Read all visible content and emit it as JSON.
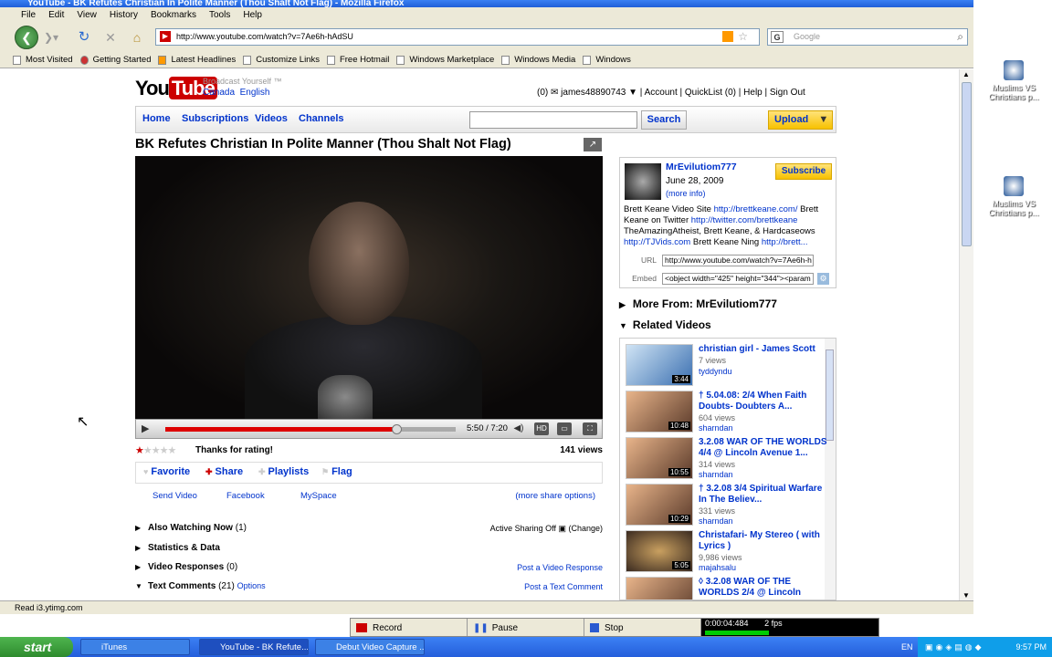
{
  "window": {
    "title": "YouTube - BK Refutes Christian In Polite Manner (Thou Shalt Not Flag) - Mozilla Firefox"
  },
  "menu": [
    "File",
    "Edit",
    "View",
    "History",
    "Bookmarks",
    "Tools",
    "Help"
  ],
  "address": {
    "url": "http://www.youtube.com/watch?v=7Ae6h-hAdSU",
    "search_placeholder": "Google"
  },
  "bookmarks": [
    "Most Visited",
    "Getting Started",
    "Latest Headlines",
    "Customize Links",
    "Free Hotmail",
    "Windows Marketplace",
    "Windows Media",
    "Windows"
  ],
  "status_text": "Read i3.ytimg.com",
  "yt": {
    "logo_you": "You",
    "logo_tube": "Tube",
    "tagline": "Broadcast Yourself ™",
    "region": "Canada",
    "language": "English",
    "user_bar": "(0) ✉  james48890743 ▼  |  Account  |  QuickList (0)  |  Help  |  Sign Out",
    "nav": [
      "Home",
      "Subscriptions",
      "Videos",
      "Channels"
    ],
    "search_button": "Search",
    "upload_button": "Upload",
    "video_title": "BK Refutes Christian In Polite Manner (Thou Shalt Not Flag)",
    "player": {
      "time": "5:50 / 7:20",
      "progress": 0.8,
      "hd_label": "HD"
    },
    "rating": {
      "stars": 1,
      "message": "Thanks for rating!",
      "views": "141 views"
    },
    "actions": [
      "Favorite",
      "Share",
      "Playlists",
      "Flag"
    ],
    "share_links": [
      "Send Video",
      "Facebook",
      "MySpace",
      "(more share options)"
    ],
    "sections": [
      {
        "label": "Also Watching Now",
        "count": "(1)",
        "right": "Active Sharing Off ▣ (Change)"
      },
      {
        "label": "Statistics & Data",
        "count": "",
        "right": ""
      },
      {
        "label": "Video Responses",
        "count": "(0)",
        "right": "Post a Video Response"
      },
      {
        "label": "Text Comments",
        "count": "(21)",
        "extra": "Options",
        "right": "Post a Text Comment"
      }
    ],
    "channel": {
      "name": "MrEvilutiom777",
      "date": "June 28, 2009",
      "more_info": "(more info)",
      "subscribe": "Subscribe",
      "desc_1": "Brett Keane Video Site ",
      "desc_link_1": "http://brettkeane.com/",
      "desc_2": " Brett Keane on Twitter ",
      "desc_link_2": "http://twitter.com/brettkeane",
      "desc_3": " TheAmazingAtheist, Brett Keane, & Hardcaseows ",
      "desc_link_3": "http://TJVids.com",
      "desc_4": " Brett Keane Ning ",
      "desc_link_4": "http://brett...",
      "url_label": "URL",
      "url_value": "http://www.youtube.com/watch?v=7Ae6h-h",
      "embed_label": "Embed",
      "embed_value": "<object width=\"425\" height=\"344\"><param"
    },
    "more_from": "More From: MrEvilutiom777",
    "related_header": "Related Videos",
    "related": [
      {
        "title": "christian girl - James Scott",
        "views": "7 views",
        "user": "tyddyndu",
        "duration": "3:44"
      },
      {
        "title": "† 5.04.08: 2/4 When Faith Doubts- Doubters A...",
        "views": "604 views",
        "user": "sharndan",
        "duration": "10:48"
      },
      {
        "title": "3.2.08 WAR OF THE WORLDS 4/4 @ Lincoln Avenue 1...",
        "views": "314 views",
        "user": "sharndan",
        "duration": "10:55"
      },
      {
        "title": "† 3.2.08 3/4 Spiritual Warfare In The Believ...",
        "views": "331 views",
        "user": "sharndan",
        "duration": "10:29"
      },
      {
        "title": "Christafari- My Stereo ( with Lyrics )",
        "views": "9,986 views",
        "user": "majahsalu",
        "duration": "5:05"
      },
      {
        "title": "◊ 3.2.08 WAR OF THE WORLDS 2/4 @ Lincoln",
        "views": "",
        "user": "",
        "duration": ""
      }
    ]
  },
  "desktop_icons": [
    "Muslims VS Christians p...",
    "Muslims VS Christians p..."
  ],
  "recorder": {
    "record": "Record",
    "pause": "Pause",
    "stop": "Stop",
    "elapsed": "0:00:04:484",
    "fps": "2 fps"
  },
  "taskbar": {
    "start": "start",
    "tasks": [
      "iTunes",
      "YouTube - BK Refute...",
      "Debut Video Capture ..."
    ],
    "lang": "EN",
    "clock": "9:57 PM"
  }
}
